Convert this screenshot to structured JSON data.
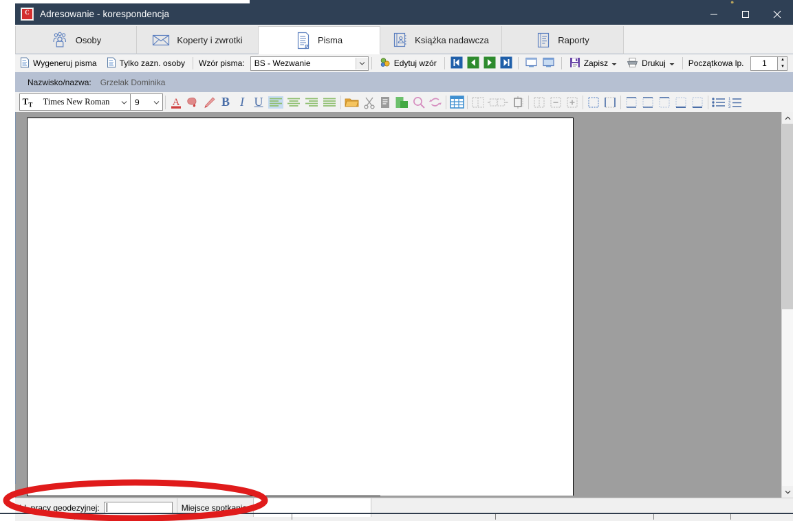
{
  "window": {
    "title": "Adresowanie - korespondencja",
    "app_icon": "app-logo-icon",
    "controls": {
      "minimize": "minimize-icon",
      "maximize": "maximize-icon",
      "close": "close-icon"
    },
    "titlebar_color": "#2f4055"
  },
  "tabs": [
    {
      "label": "Osoby",
      "icon": "people-icon",
      "active": false
    },
    {
      "label": "Koperty i zwrotki",
      "icon": "envelope-icon",
      "active": false
    },
    {
      "label": "Pisma",
      "icon": "document-icon",
      "active": true
    },
    {
      "label": "Książka nadawcza",
      "icon": "address-book-icon",
      "active": false
    },
    {
      "label": "Raporty",
      "icon": "report-icon",
      "active": false
    }
  ],
  "toolbar": {
    "generate_label": "Wygeneruj pisma",
    "generate_icon": "document-page-icon",
    "only_selected_label": "Tylko zazn. osoby",
    "only_selected_icon": "document-page-icon",
    "template_label": "Wzór pisma:",
    "template_value": "BS - Wezwanie",
    "template_dropdown_icon": "chevron-down-icon",
    "edit_template_label": "Edytuj wzór",
    "edit_template_icon": "edit-template-icon",
    "nav_first_icon": "nav-first-icon",
    "nav_prev_icon": "nav-prev-icon",
    "nav_next_icon": "nav-next-icon",
    "nav_last_icon": "nav-last-icon",
    "view_single_icon": "view-single-page-icon",
    "view_double_icon": "view-double-page-icon",
    "save_label": "Zapisz",
    "save_icon": "floppy-save-icon",
    "save_caret_icon": "caret-down-icon",
    "print_label": "Drukuj",
    "print_icon": "printer-icon",
    "print_caret_icon": "caret-down-icon",
    "start_no_label": "Początkowa lp.",
    "start_no_value": "1",
    "spinner_up_icon": "spinner-up-icon",
    "spinner_down_icon": "spinner-down-icon"
  },
  "record": {
    "name_label": "Nazwisko/nazwa:",
    "name_value": "Grzelak Dominika"
  },
  "format_toolbar": {
    "font_icon": "font-style-icon",
    "font_name": "Times New Roman",
    "font_dropdown_icon": "chevron-down-icon",
    "font_size": "9",
    "size_dropdown_icon": "chevron-down-icon",
    "buttons": [
      {
        "name": "font-color-icon",
        "glyph": "A"
      },
      {
        "name": "highlight-color-icon",
        "glyph": ""
      },
      {
        "name": "format-painter-icon",
        "glyph": ""
      },
      {
        "name": "bold-icon",
        "glyph": "B"
      },
      {
        "name": "italic-icon",
        "glyph": "I"
      },
      {
        "name": "underline-icon",
        "glyph": "U"
      },
      {
        "name": "align-left-icon",
        "glyph": ""
      },
      {
        "name": "align-center-icon",
        "glyph": ""
      },
      {
        "name": "align-right-icon",
        "glyph": ""
      },
      {
        "name": "align-justify-icon",
        "glyph": ""
      },
      {
        "name": "open-folder-icon",
        "glyph": ""
      },
      {
        "name": "cut-icon",
        "glyph": ""
      },
      {
        "name": "copy-icon",
        "glyph": ""
      },
      {
        "name": "paste-icon",
        "glyph": ""
      },
      {
        "name": "find-icon",
        "glyph": ""
      },
      {
        "name": "replace-icon",
        "glyph": ""
      },
      {
        "name": "insert-table-icon",
        "glyph": ""
      },
      {
        "name": "table-select-icon",
        "glyph": ""
      },
      {
        "name": "table-column-width-icon",
        "glyph": ""
      },
      {
        "name": "table-row-height-icon",
        "glyph": ""
      },
      {
        "name": "merge-cells-icon",
        "glyph": ""
      },
      {
        "name": "delete-row-icon",
        "glyph": ""
      },
      {
        "name": "insert-row-icon",
        "glyph": ""
      },
      {
        "name": "table-borders-none-icon",
        "glyph": ""
      },
      {
        "name": "table-borders-all-icon",
        "glyph": ""
      },
      {
        "name": "border-grid-icon",
        "glyph": ""
      },
      {
        "name": "border-outside-icon",
        "glyph": ""
      },
      {
        "name": "border-inside-icon",
        "glyph": ""
      },
      {
        "name": "border-top-icon",
        "glyph": ""
      },
      {
        "name": "border-bottom-icon",
        "glyph": ""
      },
      {
        "name": "bullet-list-icon",
        "glyph": ""
      },
      {
        "name": "numbered-list-icon",
        "glyph": ""
      }
    ]
  },
  "document": {
    "page_background": "#ffffff",
    "canvas_background": "#9e9e9e",
    "content": ""
  },
  "scrollbar": {
    "up_icon": "scroll-up-icon",
    "down_icon": "scroll-down-icon",
    "thumb": "scroll-thumb"
  },
  "statusbar": {
    "job_id_label": "Id. pracy geodezyjnej:",
    "job_id_value": "",
    "meeting_place_label": "Miejsce spotkania:",
    "meeting_place_value": ""
  },
  "annotation": {
    "shape": "red-ellipse-highlight",
    "color": "#e01b1b"
  }
}
